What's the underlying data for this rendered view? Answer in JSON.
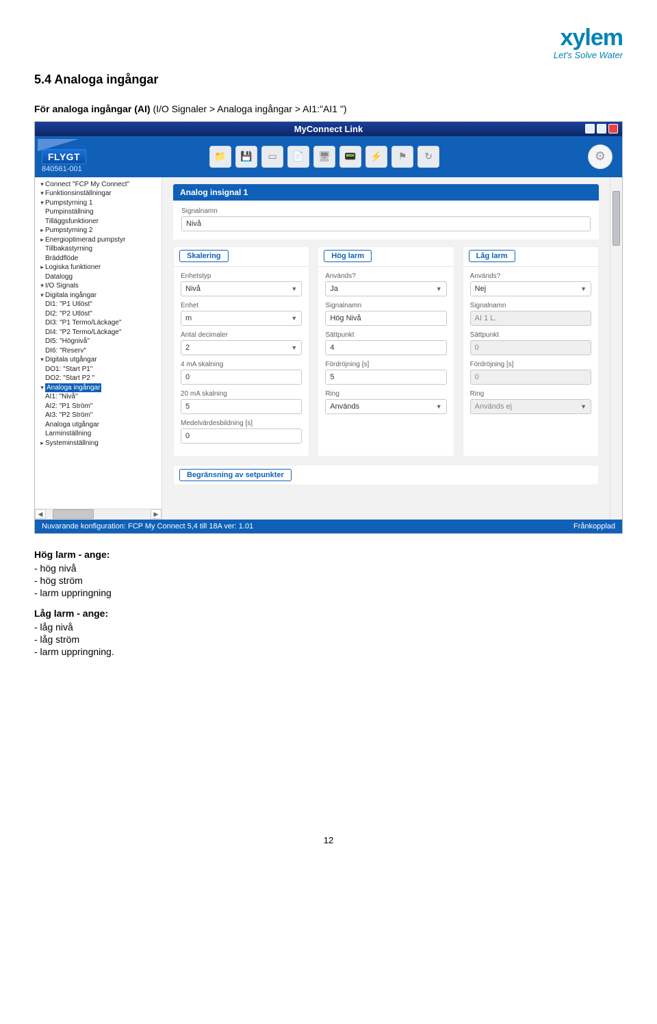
{
  "logo": {
    "main": "xylem",
    "tagline": "Let's Solve Water"
  },
  "heading": "5.4 Analoga ingångar",
  "intro_lead": "För analoga ingångar (AI) ",
  "intro_rest": "(I/O Signaler > Analoga ingångar > AI1:\"AI1 \")",
  "app": {
    "title": "MyConnect Link",
    "brand": "FLYGT",
    "sku": "840561-001",
    "toolbar_icons": [
      "folder-icon",
      "save-icon",
      "card-icon",
      "doc-icon",
      "monitor-icon",
      "sensor-icon",
      "bolt-icon",
      "flag-icon",
      "refresh-icon"
    ],
    "gear": "⚙",
    "tree": [
      {
        "l": 0,
        "t": "▾",
        "txt": "Connect \"FCP My Connect\""
      },
      {
        "l": 1,
        "t": "▾",
        "txt": "Funktionsinställningar"
      },
      {
        "l": 2,
        "t": "▾",
        "txt": "Pumpstyrning 1"
      },
      {
        "l": 3,
        "t": "",
        "txt": "Pumpinställning"
      },
      {
        "l": 3,
        "t": "",
        "txt": "Tilläggsfunktioner"
      },
      {
        "l": 2,
        "t": "▸",
        "txt": "Pumpstyrning 2"
      },
      {
        "l": 2,
        "t": "▸",
        "txt": "Energioptimerad pumpstyr"
      },
      {
        "l": 2,
        "t": "",
        "txt": "Tillbakastyrning"
      },
      {
        "l": 2,
        "t": "",
        "txt": "Bräddflöde"
      },
      {
        "l": 2,
        "t": "▸",
        "txt": "Logiska funktioner"
      },
      {
        "l": 2,
        "t": "",
        "txt": "Datalogg"
      },
      {
        "l": 1,
        "t": "▾",
        "txt": "I/O Signals"
      },
      {
        "l": 2,
        "t": "▾",
        "txt": "Digitala ingångar"
      },
      {
        "l": 3,
        "t": "",
        "txt": "DI1: \"P1 Utlöst\""
      },
      {
        "l": 3,
        "t": "",
        "txt": "DI2: \"P2 Utlöst\""
      },
      {
        "l": 3,
        "t": "",
        "txt": "DI3: \"P1 Termo/Läckage\""
      },
      {
        "l": 3,
        "t": "",
        "txt": "DI4: \"P2 Termo/Läckage\""
      },
      {
        "l": 3,
        "t": "",
        "txt": "DI5: \"Högnivå\""
      },
      {
        "l": 3,
        "t": "",
        "txt": "DI6: \"Reserv\""
      },
      {
        "l": 2,
        "t": "▾",
        "txt": "Digitala utgångar"
      },
      {
        "l": 3,
        "t": "",
        "txt": "DO1: \"Start P1\""
      },
      {
        "l": 3,
        "t": "",
        "txt": "DO2: \"Start P2 \""
      },
      {
        "l": 2,
        "t": "▾",
        "txt": "Analoga ingångar",
        "sel": true
      },
      {
        "l": 3,
        "t": "",
        "txt": "AI1: \"Nivå\""
      },
      {
        "l": 3,
        "t": "",
        "txt": "AI2: \"P1 Ström\""
      },
      {
        "l": 3,
        "t": "",
        "txt": "AI3: \"P2 Ström\""
      },
      {
        "l": 2,
        "t": "",
        "txt": "Analoga utgångar"
      },
      {
        "l": 1,
        "t": "",
        "txt": "Larminställning"
      },
      {
        "l": 1,
        "t": "▸",
        "txt": "Systeminställning"
      }
    ],
    "panel": {
      "title": "Analog insignal 1",
      "sig_label": "Signalnamn",
      "sig_value": "Nivå"
    },
    "cols": {
      "c1": {
        "heading": "Skalering",
        "g1_l": "Enhetstyp",
        "g1_v": "Nivå",
        "g2_l": "Enhet",
        "g2_v": "m",
        "g3_l": "Antal decimaler",
        "g3_v": "2",
        "g4_l": "4 mA skalning",
        "g4_v": "0",
        "g5_l": "20 mA skalning",
        "g5_v": "5",
        "g6_l": "Medelvärdesbildning [s]",
        "g6_v": "0"
      },
      "c2": {
        "heading": "Hög larm",
        "g1_l": "Används?",
        "g1_v": "Ja",
        "g2_l": "Signalnamn",
        "g2_v": "Hög Nivå",
        "g3_l": "Sättpunkt",
        "g3_v": "4",
        "g4_l": "Fördröjning [s]",
        "g4_v": "5",
        "g5_l": "Ring",
        "g5_v": "Används"
      },
      "c3": {
        "heading": "Låg larm",
        "g1_l": "Används?",
        "g1_v": "Nej",
        "g2_l": "Signalnamn",
        "g2_v": "AI 1 L.",
        "g3_l": "Sättpunkt",
        "g3_v": "0",
        "g4_l": "Fördröjning [s]",
        "g4_v": "0",
        "g5_l": "Ring",
        "g5_v": "Används ej"
      }
    },
    "collapse": "Begränsning av setpunkter",
    "status_left_label": "Nuvarande konfiguration:",
    "status_left_value": " FCP My Connect 5,4 till 18A ver: 1.01",
    "status_right": "Frånkopplad"
  },
  "hog": {
    "h": "Hög larm - ange:",
    "l1": "- hög nivå",
    "l2": "- hög ström",
    "l3": "- larm uppringning"
  },
  "lag": {
    "h": "Låg larm - ange:",
    "l1": "- låg nivå",
    "l2": "- låg ström",
    "l3": "- larm uppringning."
  },
  "pagenum": "12"
}
